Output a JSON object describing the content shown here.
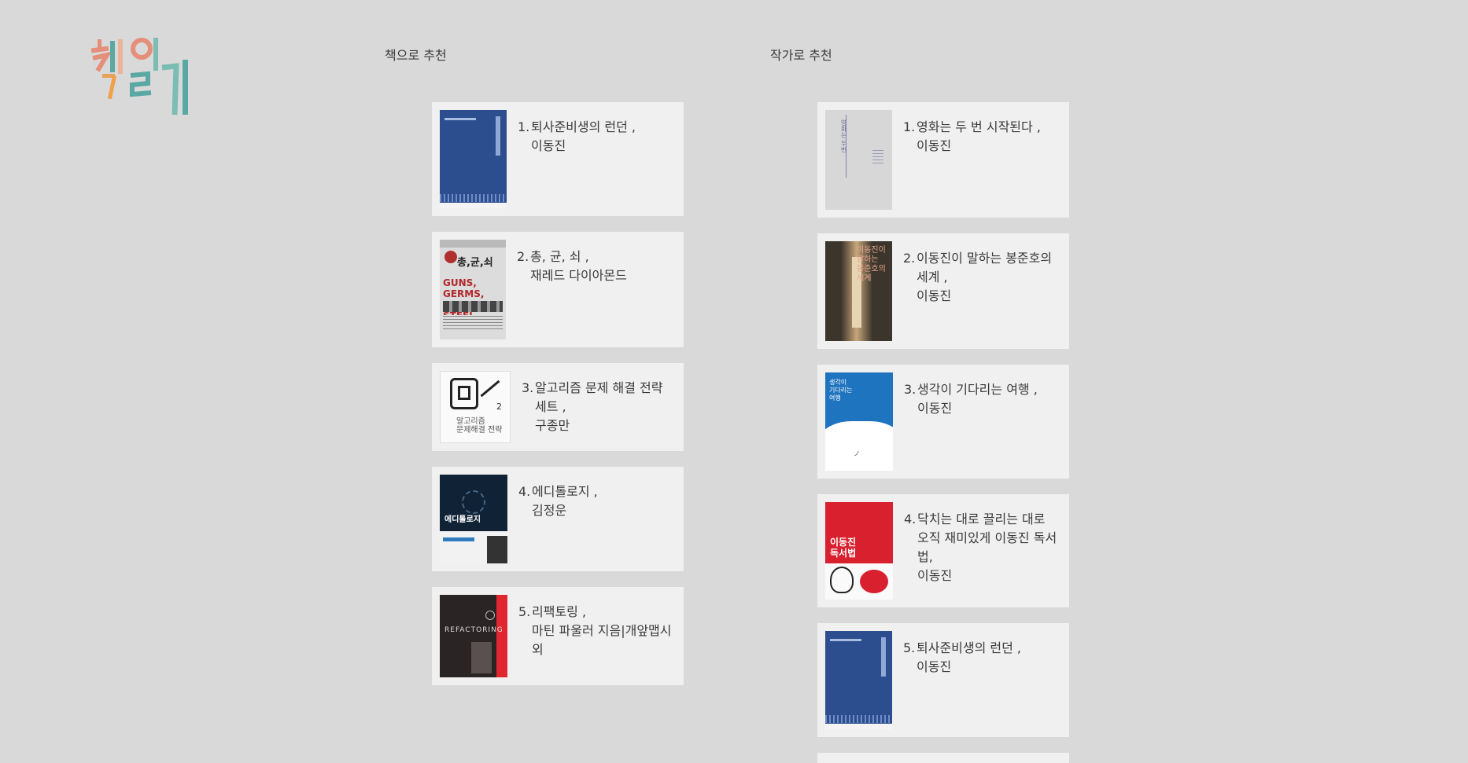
{
  "sections": {
    "by_book": "책으로 추천",
    "by_author": "작가로 추천"
  },
  "logo_text": "책읽기",
  "book_list": [
    {
      "num": "1.",
      "title": "퇴사준비생의 런던 ,",
      "author": "이동진"
    },
    {
      "num": "2.",
      "title": "총, 균, 쇠 ,",
      "author": "재레드 다이아몬드"
    },
    {
      "num": "3.",
      "title": "알고리즘 문제 해결 전략 세트 ,",
      "author": "구종만"
    },
    {
      "num": "4.",
      "title": "에디톨로지 ,",
      "author": "김정운"
    },
    {
      "num": "5.",
      "title": "리팩토링 ,",
      "author": "마틴 파울러 지음|개앞맵시 외"
    }
  ],
  "author_list": [
    {
      "num": "1.",
      "title": "영화는 두 번 시작된다 ,",
      "author": "이동진"
    },
    {
      "num": "2.",
      "title": "이동진이 말하는 봉준호의 세계 ,",
      "author": "이동진"
    },
    {
      "num": "3.",
      "title": "생각이 기다리는 여행 ,",
      "author": "이동진"
    },
    {
      "num": "4.",
      "title": "닥치는 대로 끌리는 대로 오직 재미있게 이동진 독서법,",
      "author": "이동진"
    },
    {
      "num": "5.",
      "title": "퇴사준비생의 런던 ,",
      "author": "이동진"
    }
  ],
  "colors": {
    "background": "#d9d9d9",
    "card": "#f0f0f0",
    "text": "#3a3a3a"
  }
}
